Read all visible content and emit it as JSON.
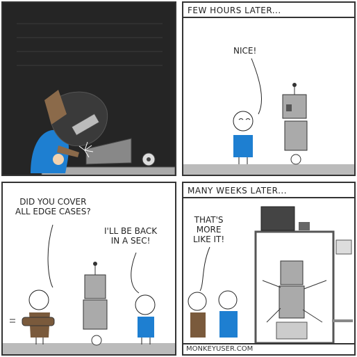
{
  "panels": {
    "p2_caption": "FEW HOURS LATER...",
    "p2_speech": "NICE!",
    "p3_speech_left": "DID YOU COVER\nALL EDGE CASES?",
    "p3_speech_right": "I'LL BE BACK\nIN A SEC!",
    "p4_caption": "MANY WEEKS LATER...",
    "p4_speech": "THAT'S\nMORE\nLIKE IT!"
  },
  "footer": {
    "credit": "MONKEYUSER.COM"
  },
  "colors": {
    "dark_bg": "#252525",
    "shirt_blue": "#1e7fd1",
    "jacket_brown": "#7a5a3c"
  }
}
